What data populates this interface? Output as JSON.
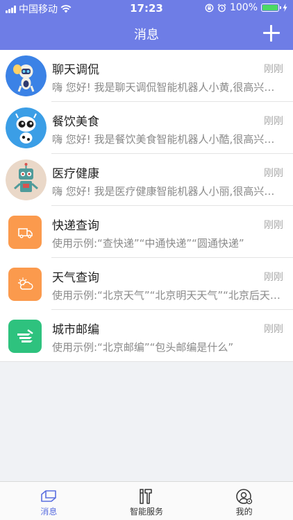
{
  "status_bar": {
    "carrier": "中国移动",
    "time": "17:23",
    "battery": "100%",
    "battery_level": 1.0
  },
  "header": {
    "title": "消息",
    "add_icon": "plus-icon"
  },
  "conversations": [
    {
      "title": "聊天调侃",
      "time": "刚刚",
      "preview": "嗨 您好! 我是聊天调侃智能机器人小黄,很高兴为您服务",
      "icon": "chat-robot-avatar",
      "color": "#3b82e6"
    },
    {
      "title": "餐饮美食",
      "time": "刚刚",
      "preview": "嗨 您好! 我是餐饮美食智能机器人小酷,很高兴为您服务",
      "icon": "food-robot-avatar",
      "color": "#3b9ee6"
    },
    {
      "title": "医疗健康",
      "time": "刚刚",
      "preview": "嗨 您好! 我是医疗健康智能机器人小丽,很高兴为您服务",
      "icon": "health-robot-avatar",
      "color": "#ead8c8"
    },
    {
      "title": "快递查询",
      "time": "刚刚",
      "preview": "使用示例:“查快递”“中通快递”“圆通快递”",
      "icon": "truck-icon",
      "color": "#fb9a4d"
    },
    {
      "title": "天气查询",
      "time": "刚刚",
      "preview": "使用示例:“北京天气”“北京明天天气”“北京后天天气”",
      "icon": "weather-icon",
      "color": "#fb9a4d"
    },
    {
      "title": "城市邮编",
      "time": "刚刚",
      "preview": "使用示例:“北京邮编”“包头邮编是什么”",
      "icon": "postal-icon",
      "color": "#2ec27e"
    }
  ],
  "tabs": [
    {
      "label": "消息",
      "icon": "message-tab-icon",
      "active": true
    },
    {
      "label": "智能服务",
      "icon": "tools-tab-icon",
      "active": false
    },
    {
      "label": "我的",
      "icon": "profile-tab-icon",
      "active": false
    }
  ],
  "accent_color": "#6e7de6"
}
